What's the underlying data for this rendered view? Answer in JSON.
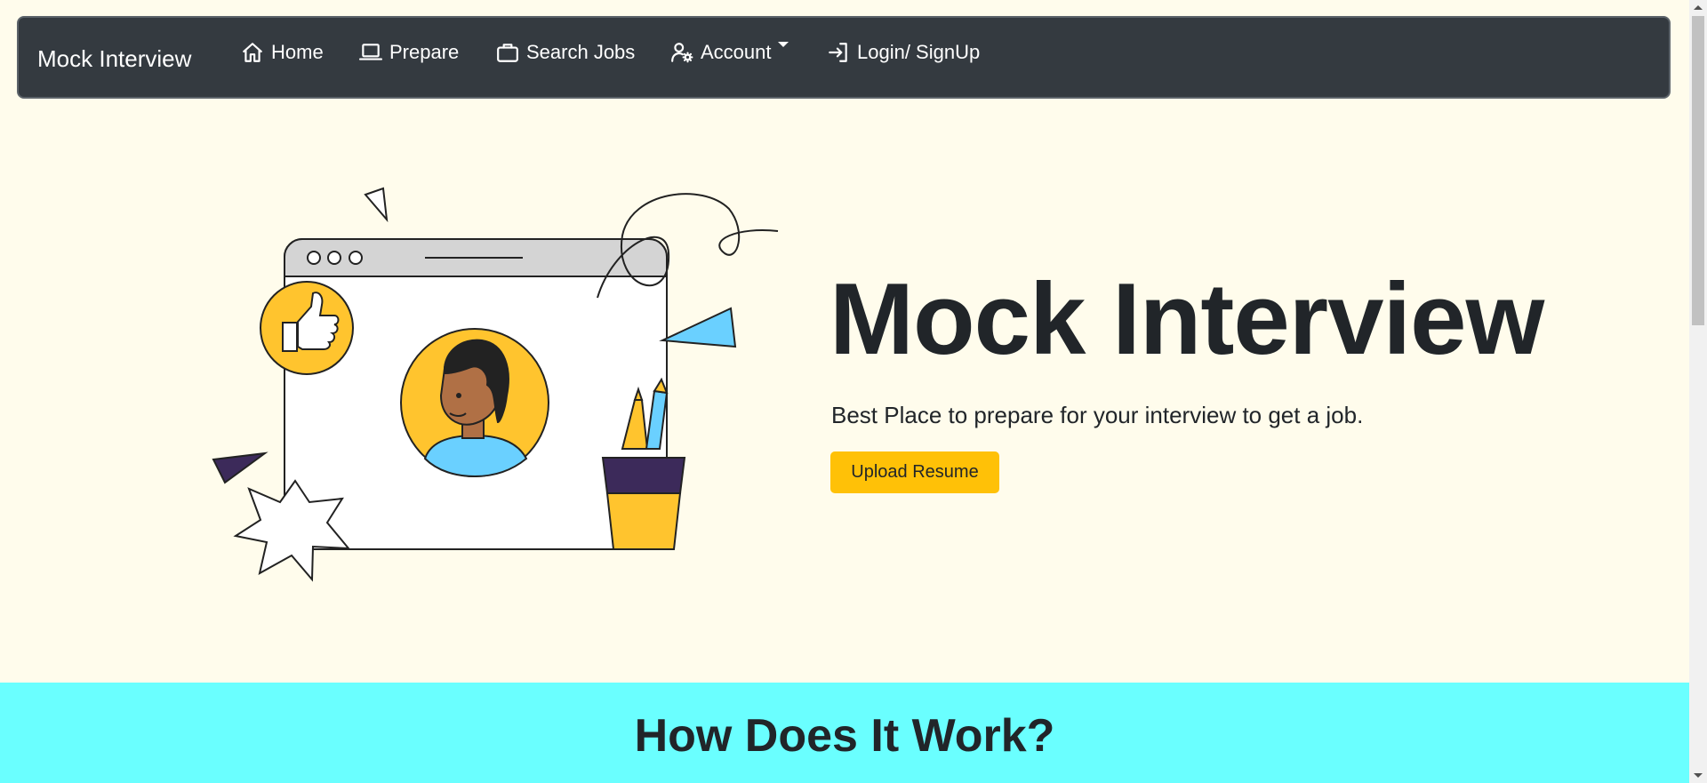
{
  "navbar": {
    "brand": "Mock Interview",
    "items": [
      {
        "label": "Home",
        "icon": "home-icon"
      },
      {
        "label": "Prepare",
        "icon": "laptop-icon"
      },
      {
        "label": "Search Jobs",
        "icon": "briefcase-icon"
      },
      {
        "label": "Account",
        "icon": "user-gear-icon"
      },
      {
        "label": "Login/ SignUp",
        "icon": "login-icon"
      }
    ]
  },
  "hero": {
    "title": "Mock Interview",
    "subtitle": "Best Place to prepare for your interview to get a job.",
    "upload_label": "Upload Resume"
  },
  "how": {
    "title": "How Does It Work?"
  },
  "colors": {
    "page_bg": "#fffcec",
    "navbar_bg": "#343a40",
    "accent_yellow": "#ffc107",
    "section_cyan": "#6affff"
  }
}
